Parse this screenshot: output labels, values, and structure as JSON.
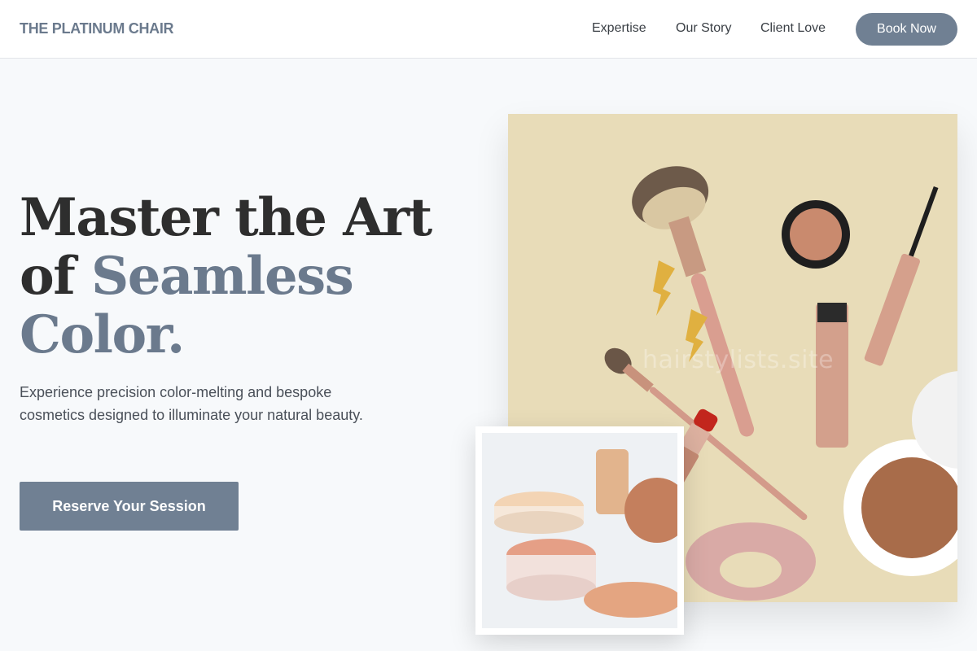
{
  "header": {
    "logo": "THE PLATINUM CHAIR",
    "nav": [
      "Expertise",
      "Our Story",
      "Client Love"
    ],
    "cta": "Book Now"
  },
  "hero": {
    "headline_line1": "Master the Art",
    "headline_of": "of ",
    "headline_accent1": "Seamless",
    "headline_accent2": "Color.",
    "subtext": "Experience precision color-melting and bespoke cosmetics designed to illuminate your natural beauty.",
    "cta": "Reserve Your Session"
  },
  "images": {
    "main_watermark": "hairstylists.site"
  },
  "colors": {
    "accent": "#708093",
    "logo": "#6b7a8d",
    "background": "#f7f9fb",
    "image_bg": "#e8dcb8"
  }
}
